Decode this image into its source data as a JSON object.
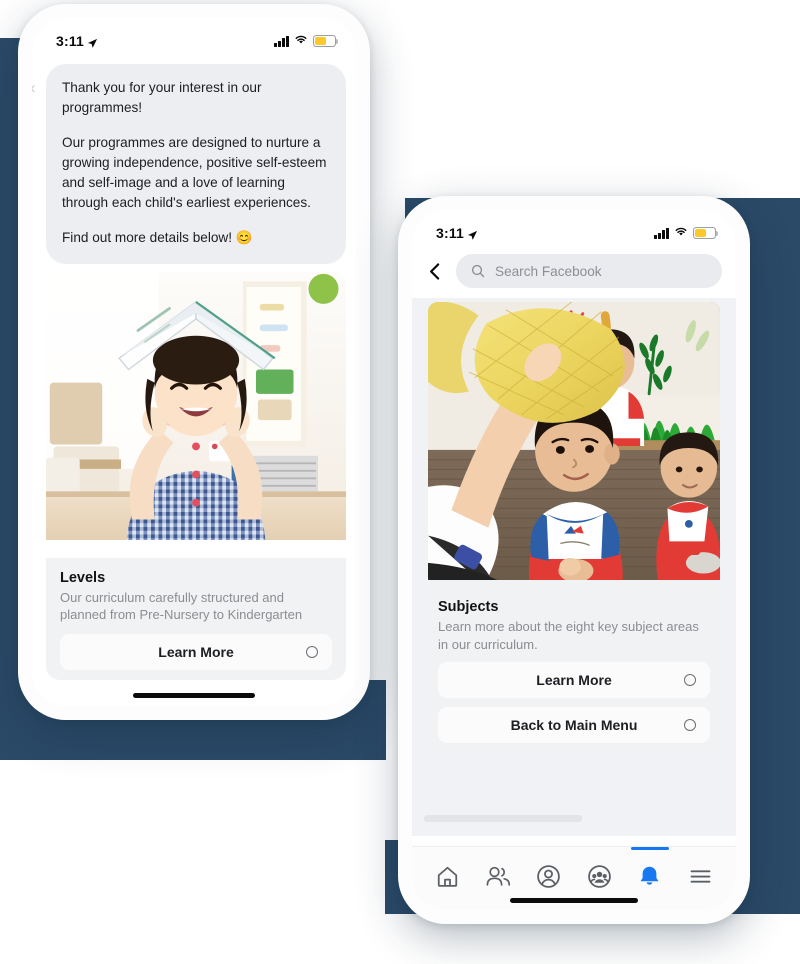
{
  "phone1": {
    "status": {
      "time": "3:11",
      "location_icon": "location-arrow-icon",
      "signal_icon": "cellular-bars-icon",
      "wifi_icon": "wifi-icon",
      "battery_icon": "battery-low-power-icon"
    },
    "message": {
      "paragraph1": "Thank you for your interest in our programmes!",
      "paragraph2": "Our programmes are designed to nurture a growing independence, positive self-esteem and self-image and a love of learning through each child's earliest experiences.",
      "paragraph3": "Find out more details below! 😊"
    },
    "card": {
      "image_alt": "young girl holding an open book over her head in a classroom",
      "title": "Levels",
      "subtitle": "Our curriculum carefully structured and planned from Pre-Nursery to Kindergarten",
      "buttons": [
        {
          "label": "Learn More",
          "indicator_icon": "circle-outline-icon"
        }
      ]
    }
  },
  "phone2": {
    "status": {
      "time": "3:11",
      "location_icon": "location-arrow-icon",
      "signal_icon": "cellular-bars-icon",
      "wifi_icon": "wifi-icon",
      "battery_icon": "battery-low-power-icon"
    },
    "header": {
      "back_icon": "chevron-left-icon",
      "search_icon": "search-icon",
      "search_placeholder": "Search Facebook",
      "search_value": ""
    },
    "card": {
      "image_alt": "toddlers sitting on a mat in a classroom while a teacher holds up a yellow net",
      "title": "Subjects",
      "subtitle": "Learn more about the eight key subject areas in our curriculum.",
      "buttons": [
        {
          "label": "Learn More",
          "indicator_icon": "circle-outline-icon"
        },
        {
          "label": "Back to Main Menu",
          "indicator_icon": "circle-outline-icon"
        }
      ]
    },
    "nav": [
      {
        "name": "home",
        "icon": "home-icon",
        "active": false
      },
      {
        "name": "friends",
        "icon": "friends-icon",
        "active": false
      },
      {
        "name": "profile",
        "icon": "profile-circle-icon",
        "active": false
      },
      {
        "name": "groups",
        "icon": "groups-icon",
        "active": false
      },
      {
        "name": "notifications",
        "icon": "bell-icon",
        "active": true
      },
      {
        "name": "menu",
        "icon": "hamburger-menu-icon",
        "active": false
      }
    ]
  },
  "theme": {
    "navy": "#2a4a68",
    "facebook_blue": "#1778f2",
    "bubble_grey": "#eceef1",
    "card_grey": "#f1f2f4",
    "battery_yellow": "#fdc82a"
  }
}
